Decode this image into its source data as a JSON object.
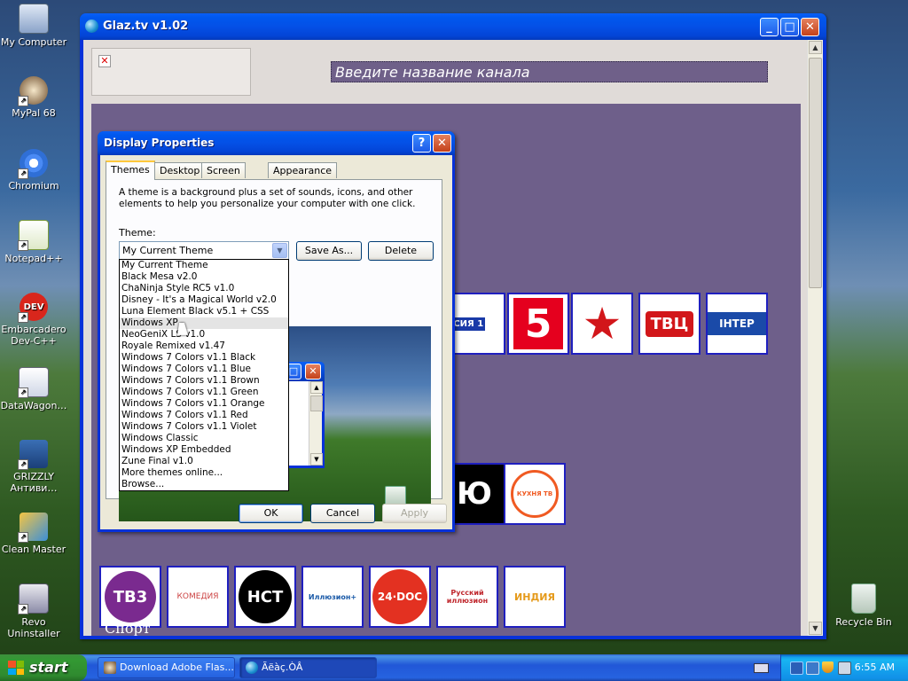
{
  "desktop": {
    "icons": [
      {
        "label": "My Computer"
      },
      {
        "label": "MyPal 68"
      },
      {
        "label": "Chromium"
      },
      {
        "label": "Notepad++"
      },
      {
        "label": "Embarcadero Dev-C++",
        "icon_text": "DEV"
      },
      {
        "label": "DataWagon…"
      },
      {
        "label": "GRIZZLY Антиви…"
      },
      {
        "label": "Clean Master"
      },
      {
        "label": "Revo Uninstaller"
      },
      {
        "label": "Recycle Bin"
      }
    ]
  },
  "main_window": {
    "title": "Glaz.tv v1.02",
    "search_placeholder": "Введите название канала",
    "sections": [
      {
        "title": "Спорт"
      }
    ],
    "channels_row1": [
      {
        "name": "Россия 1",
        "text": "ССИЯ 1",
        "color": "#1a3aa8"
      },
      {
        "name": "Пятый канал",
        "text": "5",
        "color": "#e5001e"
      },
      {
        "name": "Звезда",
        "text": "★",
        "color": "#d2161a"
      },
      {
        "name": "ТВЦ",
        "text": "ТВЦ",
        "color": "#d2161a"
      },
      {
        "name": "Интер",
        "text": "ІНТЕР",
        "color": "#1a4aa8"
      }
    ],
    "channels_row2": [
      {
        "name": "Ю",
        "text": "Ю",
        "color": "#000000"
      },
      {
        "name": "Кухня ТВ",
        "text": "КУХНЯ ТВ",
        "color": "#f05a22"
      }
    ],
    "channels_row3": [
      {
        "name": "ТВ3",
        "text": "ТВ3",
        "color": "#7a2a8f"
      },
      {
        "name": "Комедия",
        "text": "КОМЕДИЯ",
        "color": "#c44"
      },
      {
        "name": "НСТ",
        "text": "НСТ",
        "color": "#000000"
      },
      {
        "name": "Иллюзион+",
        "text": "Иллюзион+",
        "color": "#1a5aa8"
      },
      {
        "name": "24 DOC",
        "text": "24·DOC",
        "color": "#e33121"
      },
      {
        "name": "Русский иллюзион",
        "text": "Русский иллюзион",
        "color": "#c0282e"
      },
      {
        "name": "Индия",
        "text": "ИНДИЯ",
        "color": "#e59a1a"
      }
    ]
  },
  "display_properties": {
    "title": "Display Properties",
    "tabs": [
      "Themes",
      "Desktop",
      "Screen Saver",
      "Appearance"
    ],
    "description": "A theme is a background plus a set of sounds, icons, and other elements to help you personalize your computer with one click.",
    "theme_label": "Theme:",
    "theme_selected": "My Current Theme",
    "save_as": "Save As...",
    "delete": "Delete",
    "ok": "OK",
    "cancel": "Cancel",
    "apply": "Apply",
    "theme_options": [
      "My Current Theme",
      "Black Mesa v2.0",
      "ChaNinja Style RC5 v1.0",
      "Disney - It's a Magical World v2.0",
      "Luna Element Black v5.1 + CSS",
      "Windows XP",
      "NeoGeniX LS v1.0",
      "Royale Remixed v1.47",
      "Windows 7 Colors v1.1 Black",
      "Windows 7 Colors v1.1 Blue",
      "Windows 7 Colors v1.1 Brown",
      "Windows 7 Colors v1.1 Green",
      "Windows 7 Colors v1.1 Orange",
      "Windows 7 Colors v1.1 Red",
      "Windows 7 Colors v1.1 Violet",
      "Windows Classic",
      "Windows XP Embedded",
      "Zune Final v1.0",
      "More themes online...",
      "Browse..."
    ],
    "highlighted_option": "Windows XP"
  },
  "taskbar": {
    "start_label": "start",
    "tasks": [
      {
        "label": "Download Adobe Flas...",
        "active": false
      },
      {
        "label": "Ãëàç.ÒÂ",
        "active": true
      }
    ],
    "clock": "6:55 AM"
  }
}
